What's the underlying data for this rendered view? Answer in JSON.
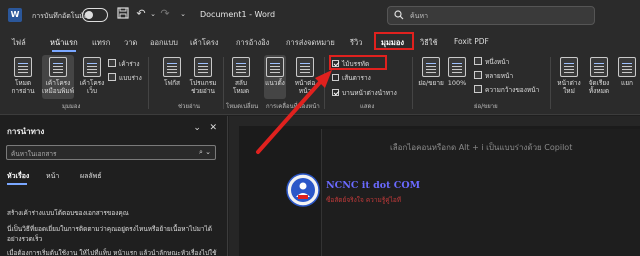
{
  "titlebar": {
    "autosave_label": "การบันทึกอัตโนมัติ",
    "doc_title": "Document1  -  Word",
    "search_placeholder": "ค้นหา"
  },
  "tabs": [
    {
      "label": "ไฟล์"
    },
    {
      "label": "หน้าแรก"
    },
    {
      "label": "แทรก"
    },
    {
      "label": "วาด"
    },
    {
      "label": "ออกแบบ"
    },
    {
      "label": "เค้าโครง"
    },
    {
      "label": "การอ้างอิง"
    },
    {
      "label": "การส่งจดหมาย"
    },
    {
      "label": "รีวิว"
    },
    {
      "label": "มุมมอง"
    },
    {
      "label": "วิธีใช้"
    },
    {
      "label": "Foxit PDF"
    }
  ],
  "ribbon": {
    "views": {
      "read_mode": "โหมดการอ่าน",
      "print_layout": "เค้าโครงเหมือนพิมพ์",
      "web_layout": "เค้าโครงเว็บ",
      "outline": "เค้าร่าง",
      "draft": "แบบร่าง",
      "group_label": "มุมมอง"
    },
    "immersive": {
      "focus": "โฟกัส",
      "immersive_reader": "โปรแกรมช่วยอ่าน",
      "group_label": "ช่วยอ่าน"
    },
    "page_movement": {
      "side_to_side": "สลับโหมด",
      "vertical": "แนวตั้ง",
      "side_by_side": "หน้าต่อหน้า",
      "group_label": "โหมดเปลี่ยน"
    },
    "show": {
      "ruler": "ไม้บรรทัด",
      "gridlines": "เส้นตาราง",
      "navigation_pane": "บานหน้าต่างนำทาง",
      "group_label": "แสดง",
      "ruler_checked": true,
      "gridlines_checked": false,
      "nav_checked": true
    },
    "zoom": {
      "zoom": "ย่อ/ขยาย",
      "hundred": "100%",
      "one_page": "หนึ่งหน้า",
      "multiple_pages": "หลายหน้า",
      "page_width": "ความกว้างของหน้า",
      "group_label": "ย่อ/ขยาย"
    },
    "window": {
      "new_window": "หน้าต่างใหม่",
      "arrange_all": "จัดเรียงทั้งหมด",
      "split": "แยก"
    },
    "group_ui": "การเคลื่อนที่ของหน้า"
  },
  "navpane": {
    "title": "การนำทาง",
    "search_placeholder": "ค้นหาในเอกสาร",
    "tabs": [
      "หัวเรื่อง",
      "หน้า",
      "ผลลัพธ์"
    ],
    "text1": "สร้างเค้าร่างแบบโต้ตอบของเอกสารของคุณ",
    "text2": "นี่เป็นวิธีที่ยอดเยี่ยมในการติดตามว่าคุณอยู่ตรงไหนหรือย้ายเนื้อหาไปมาได้อย่างรวดเร็ว",
    "text3": "เมื่อต้องการเริ่มต้นใช้งาน ให้ไปที่แท็บ หน้าแรก แล้วนำลักษณะหัวเรื่องไปใช้กับหัวเรื่องในเอกสารของคุณ"
  },
  "document": {
    "hint": "เลือกไอคอนหรือกด Alt + i เป็นแบบร่างด้วย Copilot"
  },
  "watermark": {
    "line1": "NCNC it dot COM",
    "line2": "ซื่อสัตย์จริงใจ ความรู้คู่ไอที"
  },
  "colors": {
    "highlight_red": "#e0211e",
    "accent_blue": "#7aa7ff"
  }
}
